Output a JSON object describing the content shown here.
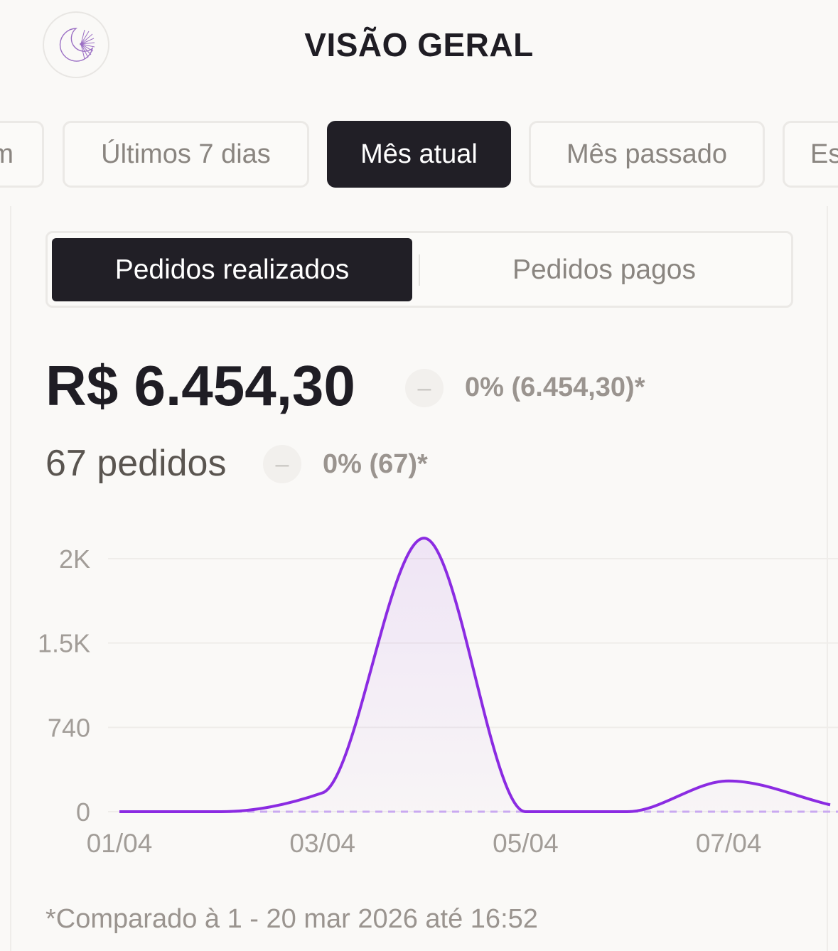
{
  "header": {
    "title": "VISÃO GERAL",
    "logo_icon": "moon-sunburst-logo-icon"
  },
  "period_filters": [
    {
      "label": "m",
      "active": false
    },
    {
      "label": "Últimos 7 dias",
      "active": false
    },
    {
      "label": "Mês atual",
      "active": true
    },
    {
      "label": "Mês passado",
      "active": false
    },
    {
      "label": "Es",
      "active": false
    }
  ],
  "order_toggle": {
    "options": [
      "Pedidos realizados",
      "Pedidos pagos"
    ],
    "selected": "Pedidos realizados"
  },
  "summary": {
    "amount": "R$ 6.454,30",
    "amount_badge": "–",
    "amount_comparison": "0% (6.454,30)*",
    "orders": "67 pedidos",
    "orders_badge": "–",
    "orders_comparison": "0% (67)*"
  },
  "chart_data": {
    "type": "area",
    "y_ticks": [
      "2K",
      "1.5K",
      "740",
      "0"
    ],
    "x_ticks": [
      "01/04",
      "03/04",
      "05/04",
      "07/04"
    ],
    "ylim": [
      0,
      1480
    ],
    "grid": true,
    "series": [
      {
        "color": "#8b2be2",
        "x": [
          1,
          2,
          3,
          4,
          5,
          6,
          7,
          8
        ],
        "values": [
          0,
          0,
          110,
          1600,
          0,
          0,
          180,
          40
        ]
      }
    ],
    "comparison_baseline": {
      "color": "#c9a9f0",
      "value": 0,
      "style": "dashed"
    }
  },
  "footnote": "*Comparado à 1 - 20 mar 2026 até 16:52"
}
